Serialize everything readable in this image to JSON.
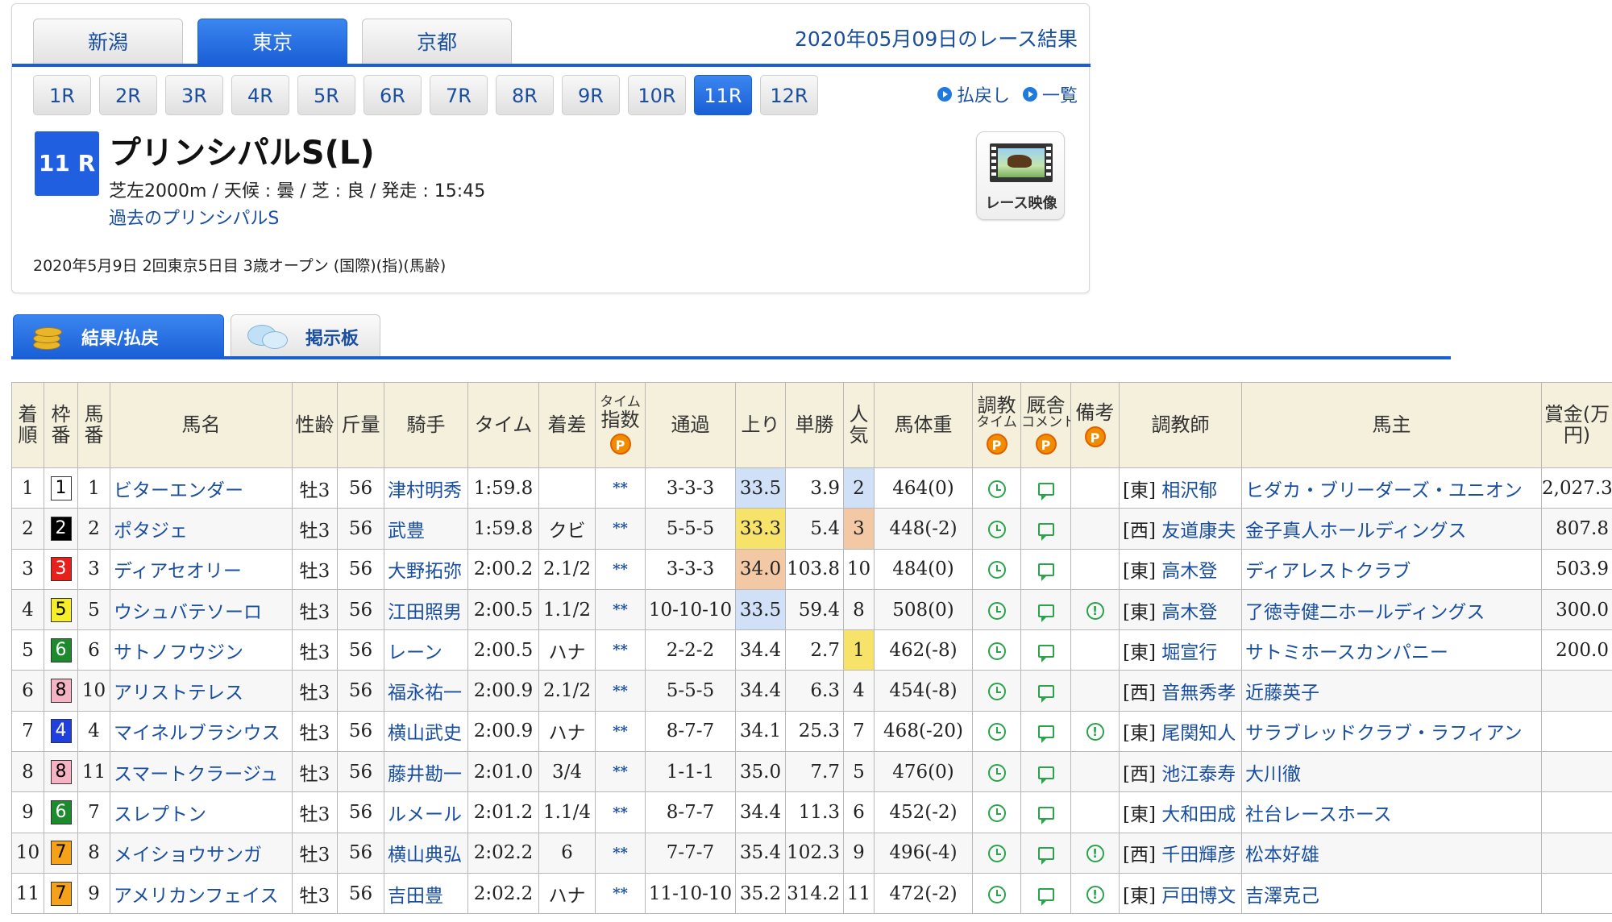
{
  "venues": [
    {
      "label": "新潟",
      "active": false
    },
    {
      "label": "東京",
      "active": true
    },
    {
      "label": "京都",
      "active": false
    }
  ],
  "race_date_title": "2020年05月09日のレース結果",
  "rounds": [
    {
      "label": "1R",
      "active": false
    },
    {
      "label": "2R",
      "active": false
    },
    {
      "label": "3R",
      "active": false
    },
    {
      "label": "4R",
      "active": false
    },
    {
      "label": "5R",
      "active": false
    },
    {
      "label": "6R",
      "active": false
    },
    {
      "label": "7R",
      "active": false
    },
    {
      "label": "8R",
      "active": false
    },
    {
      "label": "9R",
      "active": false
    },
    {
      "label": "10R",
      "active": false
    },
    {
      "label": "11R",
      "active": true
    },
    {
      "label": "12R",
      "active": false
    }
  ],
  "quick_links": {
    "payout": "払戻し",
    "list": "一覧"
  },
  "race": {
    "badge": "11 R",
    "name": "プリンシパルS(L)",
    "info": "芝左2000m / 天候 : 曇 / 芝 : 良 / 発走 : 15:45",
    "past_link": "過去のプリンシパルS",
    "meta": "2020年5月9日 2回東京5日目 3歳オープン  (国際)(指)(馬齢)",
    "video_label": "レース映像"
  },
  "section_tabs": {
    "results": "結果/払戻",
    "board": "掲示板"
  },
  "table": {
    "headers": {
      "rank": "着順",
      "frame": "枠番",
      "number": "馬番",
      "horse": "馬名",
      "sexage": "性齢",
      "weight": "斤量",
      "jockey": "騎手",
      "time": "タイム",
      "margin": "着差",
      "time_index_top": "タイム",
      "time_index_bottom": "指数",
      "passing": "通過",
      "last3f": "上り",
      "odds": "単勝",
      "popularity": "人気",
      "body_weight": "馬体重",
      "training_top": "調教",
      "training_bottom": "タイム",
      "stable_top": "厩舎",
      "stable_bottom": "コメント",
      "remarks": "備考",
      "trainer": "調教師",
      "owner": "馬主",
      "prize": "賞金(万円)",
      "p_icon": "P"
    },
    "rows": [
      {
        "rank": "1",
        "frame": "1",
        "number": "1",
        "horse": "ビターエンダー",
        "sexage": "牡3",
        "weight": "56",
        "jockey": "津村明秀",
        "time": "1:59.8",
        "margin": "",
        "index": "**",
        "passing": "3-3-3",
        "last3f": "33.5",
        "last3f_bg": "#cfe0f7",
        "odds": "3.9",
        "pop": "2",
        "pop_bg": "#cfe0f7",
        "body": "464(0)",
        "remark": false,
        "region": "[東]",
        "trainer": "相沢郁",
        "owner": "ヒダカ・ブリーダーズ・ユニオン",
        "prize": "2,027.3"
      },
      {
        "rank": "2",
        "frame": "2",
        "number": "2",
        "horse": "ポタジェ",
        "sexage": "牡3",
        "weight": "56",
        "jockey": "武豊",
        "time": "1:59.8",
        "margin": "クビ",
        "index": "**",
        "passing": "5-5-5",
        "last3f": "33.3",
        "last3f_bg": "#f7e36a",
        "odds": "5.4",
        "pop": "3",
        "pop_bg": "#f2c9a4",
        "body": "448(-2)",
        "remark": false,
        "region": "[西]",
        "trainer": "友道康夫",
        "owner": "金子真人ホールディングス",
        "prize": "807.8"
      },
      {
        "rank": "3",
        "frame": "3",
        "number": "3",
        "horse": "ディアセオリー",
        "sexage": "牡3",
        "weight": "56",
        "jockey": "大野拓弥",
        "time": "2:00.2",
        "margin": "2.1/2",
        "index": "**",
        "passing": "3-3-3",
        "last3f": "34.0",
        "last3f_bg": "#f2c9a4",
        "odds": "103.8",
        "pop": "10",
        "pop_bg": "",
        "body": "484(0)",
        "remark": false,
        "region": "[東]",
        "trainer": "高木登",
        "owner": "ディアレストクラブ",
        "prize": "503.9"
      },
      {
        "rank": "4",
        "frame": "5",
        "number": "5",
        "horse": "ウシュバテソーロ",
        "sexage": "牡3",
        "weight": "56",
        "jockey": "江田照男",
        "time": "2:00.5",
        "margin": "1.1/2",
        "index": "**",
        "passing": "10-10-10",
        "last3f": "33.5",
        "last3f_bg": "#cfe0f7",
        "odds": "59.4",
        "pop": "8",
        "pop_bg": "",
        "body": "508(0)",
        "remark": true,
        "region": "[東]",
        "trainer": "高木登",
        "owner": "了徳寺健二ホールディングス",
        "prize": "300.0"
      },
      {
        "rank": "5",
        "frame": "6",
        "number": "6",
        "horse": "サトノフウジン",
        "sexage": "牡3",
        "weight": "56",
        "jockey": "レーン",
        "time": "2:00.5",
        "margin": "ハナ",
        "index": "**",
        "passing": "2-2-2",
        "last3f": "34.4",
        "last3f_bg": "",
        "odds": "2.7",
        "pop": "1",
        "pop_bg": "#f7e36a",
        "body": "462(-8)",
        "remark": false,
        "region": "[東]",
        "trainer": "堀宣行",
        "owner": "サトミホースカンパニー",
        "prize": "200.0"
      },
      {
        "rank": "6",
        "frame": "8",
        "number": "10",
        "horse": "アリストテレス",
        "sexage": "牡3",
        "weight": "56",
        "jockey": "福永祐一",
        "time": "2:00.9",
        "margin": "2.1/2",
        "index": "**",
        "passing": "5-5-5",
        "last3f": "34.4",
        "last3f_bg": "",
        "odds": "6.3",
        "pop": "4",
        "pop_bg": "",
        "body": "454(-8)",
        "remark": false,
        "region": "[西]",
        "trainer": "音無秀孝",
        "owner": "近藤英子",
        "prize": ""
      },
      {
        "rank": "7",
        "frame": "4",
        "number": "4",
        "horse": "マイネルブラシウス",
        "sexage": "牡3",
        "weight": "56",
        "jockey": "横山武史",
        "time": "2:00.9",
        "margin": "ハナ",
        "index": "**",
        "passing": "8-7-7",
        "last3f": "34.1",
        "last3f_bg": "",
        "odds": "25.3",
        "pop": "7",
        "pop_bg": "",
        "body": "468(-20)",
        "remark": true,
        "region": "[東]",
        "trainer": "尾関知人",
        "owner": "サラブレッドクラブ・ラフィアン",
        "prize": ""
      },
      {
        "rank": "8",
        "frame": "8",
        "number": "11",
        "horse": "スマートクラージュ",
        "sexage": "牡3",
        "weight": "56",
        "jockey": "藤井勘一",
        "time": "2:01.0",
        "margin": "3/4",
        "index": "**",
        "passing": "1-1-1",
        "last3f": "35.0",
        "last3f_bg": "",
        "odds": "7.7",
        "pop": "5",
        "pop_bg": "",
        "body": "476(0)",
        "remark": false,
        "region": "[西]",
        "trainer": "池江泰寿",
        "owner": "大川徹",
        "prize": ""
      },
      {
        "rank": "9",
        "frame": "6",
        "number": "7",
        "horse": "スレプトン",
        "sexage": "牡3",
        "weight": "56",
        "jockey": "ルメール",
        "time": "2:01.2",
        "margin": "1.1/4",
        "index": "**",
        "passing": "8-7-7",
        "last3f": "34.4",
        "last3f_bg": "",
        "odds": "11.3",
        "pop": "6",
        "pop_bg": "",
        "body": "452(-2)",
        "remark": false,
        "region": "[東]",
        "trainer": "大和田成",
        "owner": "社台レースホース",
        "prize": ""
      },
      {
        "rank": "10",
        "frame": "7",
        "number": "8",
        "horse": "メイショウサンガ",
        "sexage": "牡3",
        "weight": "56",
        "jockey": "横山典弘",
        "time": "2:02.2",
        "margin": "6",
        "index": "**",
        "passing": "7-7-7",
        "last3f": "35.4",
        "last3f_bg": "",
        "odds": "102.3",
        "pop": "9",
        "pop_bg": "",
        "body": "496(-4)",
        "remark": true,
        "region": "[西]",
        "trainer": "千田輝彦",
        "owner": "松本好雄",
        "prize": ""
      },
      {
        "rank": "11",
        "frame": "7",
        "number": "9",
        "horse": "アメリカンフェイス",
        "sexage": "牡3",
        "weight": "56",
        "jockey": "吉田豊",
        "time": "2:02.2",
        "margin": "ハナ",
        "index": "**",
        "passing": "11-10-10",
        "last3f": "35.2",
        "last3f_bg": "",
        "odds": "314.2",
        "pop": "11",
        "pop_bg": "",
        "body": "472(-2)",
        "remark": true,
        "region": "[東]",
        "trainer": "戸田博文",
        "owner": "吉澤克己",
        "prize": ""
      }
    ]
  },
  "frame_colors": {
    "1": {
      "bg": "#ffffff",
      "fg": "#000000"
    },
    "2": {
      "bg": "#000000",
      "fg": "#ffffff"
    },
    "3": {
      "bg": "#e8201c",
      "fg": "#ffffff"
    },
    "4": {
      "bg": "#1f3fe0",
      "fg": "#ffffff"
    },
    "5": {
      "bg": "#f7ee2a",
      "fg": "#000000"
    },
    "6": {
      "bg": "#1e8a2e",
      "fg": "#ffffff"
    },
    "7": {
      "bg": "#f5a21a",
      "fg": "#000000"
    },
    "8": {
      "bg": "#f6b3c3",
      "fg": "#000000"
    }
  }
}
